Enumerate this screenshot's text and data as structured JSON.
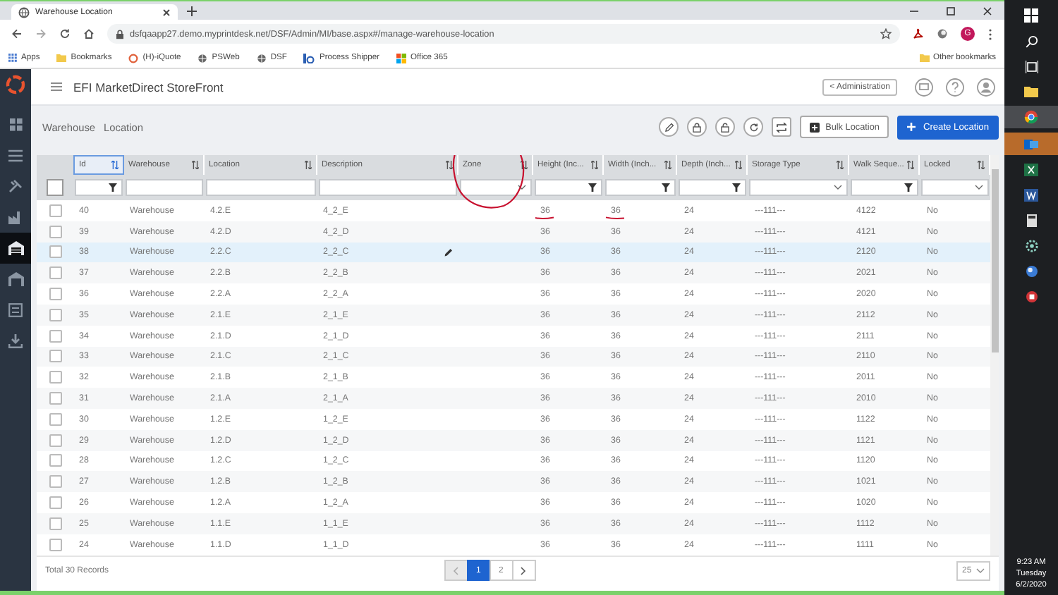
{
  "browser": {
    "tab_title": "Warehouse Location",
    "url": "dsfqaapp27.demo.myprintdesk.net/DSF/Admin/MI/base.aspx#/manage-warehouse-location",
    "profile": "G",
    "bookmarks": [
      {
        "kind": "apps",
        "label": "Apps"
      },
      {
        "kind": "folder",
        "label": "Bookmarks"
      },
      {
        "kind": "circle",
        "label": "(H)-iQuote"
      },
      {
        "kind": "globe",
        "label": "PSWeb"
      },
      {
        "kind": "globe",
        "label": "DSF"
      },
      {
        "kind": "logo",
        "label": "Process Shipper"
      },
      {
        "kind": "office",
        "label": "Office 365"
      }
    ],
    "other_bookmarks": "Other bookmarks"
  },
  "sidebar": {
    "items": [
      {
        "kind": "grid",
        "selected": false
      },
      {
        "kind": "list",
        "selected": false
      },
      {
        "kind": "tools",
        "selected": false
      },
      {
        "kind": "factory",
        "selected": false
      },
      {
        "kind": "warehouse",
        "selected": true
      },
      {
        "kind": "garage",
        "selected": false
      },
      {
        "kind": "board",
        "selected": false
      },
      {
        "kind": "download",
        "selected": false
      }
    ]
  },
  "header": {
    "app_name": "EFI MarketDirect StoreFront",
    "back_link": "< Administration"
  },
  "page": {
    "breadcrumb": [
      "Warehouse",
      "Location"
    ],
    "bulk_button": "Bulk Location",
    "create_button": "Create Location"
  },
  "table": {
    "select_all": {
      "checked": false
    },
    "columns": [
      {
        "label": "Id",
        "kind": "number",
        "sorted": true
      },
      {
        "label": "Warehouse",
        "kind": "text",
        "sorted": false
      },
      {
        "label": "Location",
        "kind": "text",
        "sorted": false
      },
      {
        "label": "Description",
        "kind": "text",
        "sorted": false
      },
      {
        "label": "Zone",
        "kind": "select",
        "sorted": false
      },
      {
        "label": "Height (Inc...",
        "kind": "number",
        "sorted": false
      },
      {
        "label": "Width (Inch...",
        "kind": "number",
        "sorted": false
      },
      {
        "label": "Depth (Inch...",
        "kind": "number",
        "sorted": false
      },
      {
        "label": "Storage Type",
        "kind": "select",
        "sorted": false
      },
      {
        "label": "Walk Seque...",
        "kind": "number",
        "sorted": false
      },
      {
        "label": "Locked",
        "kind": "select",
        "sorted": false
      }
    ],
    "rows": [
      {
        "checked": false,
        "selected": false,
        "cells": [
          "40",
          "Warehouse",
          "4.2.E",
          "4_2_E",
          "",
          "36",
          "36",
          "24",
          "---111---",
          "4122",
          "No"
        ]
      },
      {
        "checked": false,
        "selected": false,
        "cells": [
          "39",
          "Warehouse",
          "4.2.D",
          "4_2_D",
          "",
          "36",
          "36",
          "24",
          "---111---",
          "4121",
          "No"
        ]
      },
      {
        "checked": false,
        "selected": true,
        "cells": [
          "38",
          "Warehouse",
          "2.2.C",
          "2_2_C",
          "",
          "36",
          "36",
          "24",
          "---111---",
          "2120",
          "No"
        ]
      },
      {
        "checked": false,
        "selected": false,
        "cells": [
          "37",
          "Warehouse",
          "2.2.B",
          "2_2_B",
          "",
          "36",
          "36",
          "24",
          "---111---",
          "2021",
          "No"
        ]
      },
      {
        "checked": false,
        "selected": false,
        "cells": [
          "36",
          "Warehouse",
          "2.2.A",
          "2_2_A",
          "",
          "36",
          "36",
          "24",
          "---111---",
          "2020",
          "No"
        ]
      },
      {
        "checked": false,
        "selected": false,
        "cells": [
          "35",
          "Warehouse",
          "2.1.E",
          "2_1_E",
          "",
          "36",
          "36",
          "24",
          "---111---",
          "2112",
          "No"
        ]
      },
      {
        "checked": false,
        "selected": false,
        "cells": [
          "34",
          "Warehouse",
          "2.1.D",
          "2_1_D",
          "",
          "36",
          "36",
          "24",
          "---111---",
          "2111",
          "No"
        ]
      },
      {
        "checked": false,
        "selected": false,
        "cells": [
          "33",
          "Warehouse",
          "2.1.C",
          "2_1_C",
          "",
          "36",
          "36",
          "24",
          "---111---",
          "2110",
          "No"
        ]
      },
      {
        "checked": false,
        "selected": false,
        "cells": [
          "32",
          "Warehouse",
          "2.1.B",
          "2_1_B",
          "",
          "36",
          "36",
          "24",
          "---111---",
          "2011",
          "No"
        ]
      },
      {
        "checked": false,
        "selected": false,
        "cells": [
          "31",
          "Warehouse",
          "2.1.A",
          "2_1_A",
          "",
          "36",
          "36",
          "24",
          "---111---",
          "2010",
          "No"
        ]
      },
      {
        "checked": false,
        "selected": false,
        "cells": [
          "30",
          "Warehouse",
          "1.2.E",
          "1_2_E",
          "",
          "36",
          "36",
          "24",
          "---111---",
          "1122",
          "No"
        ]
      },
      {
        "checked": false,
        "selected": false,
        "cells": [
          "29",
          "Warehouse",
          "1.2.D",
          "1_2_D",
          "",
          "36",
          "36",
          "24",
          "---111---",
          "1121",
          "No"
        ]
      },
      {
        "checked": false,
        "selected": false,
        "cells": [
          "28",
          "Warehouse",
          "1.2.C",
          "1_2_C",
          "",
          "36",
          "36",
          "24",
          "---111---",
          "1120",
          "No"
        ]
      },
      {
        "checked": false,
        "selected": false,
        "cells": [
          "27",
          "Warehouse",
          "1.2.B",
          "1_2_B",
          "",
          "36",
          "36",
          "24",
          "---111---",
          "1021",
          "No"
        ]
      },
      {
        "checked": false,
        "selected": false,
        "cells": [
          "26",
          "Warehouse",
          "1.2.A",
          "1_2_A",
          "",
          "36",
          "36",
          "24",
          "---111---",
          "1020",
          "No"
        ]
      },
      {
        "checked": false,
        "selected": false,
        "cells": [
          "25",
          "Warehouse",
          "1.1.E",
          "1_1_E",
          "",
          "36",
          "36",
          "24",
          "---111---",
          "1112",
          "No"
        ]
      },
      {
        "checked": false,
        "selected": false,
        "cells": [
          "24",
          "Warehouse",
          "1.1.D",
          "1_1_D",
          "",
          "36",
          "36",
          "24",
          "---111---",
          "1111",
          "No"
        ]
      }
    ]
  },
  "footer": {
    "total": "Total 30 Records",
    "pages": [
      {
        "label": "1",
        "selected": true
      },
      {
        "label": "2",
        "selected": false
      }
    ],
    "page_size": "25"
  },
  "taskbar": {
    "time": "9:23 AM",
    "day": "Tuesday",
    "date": "6/2/2020"
  }
}
